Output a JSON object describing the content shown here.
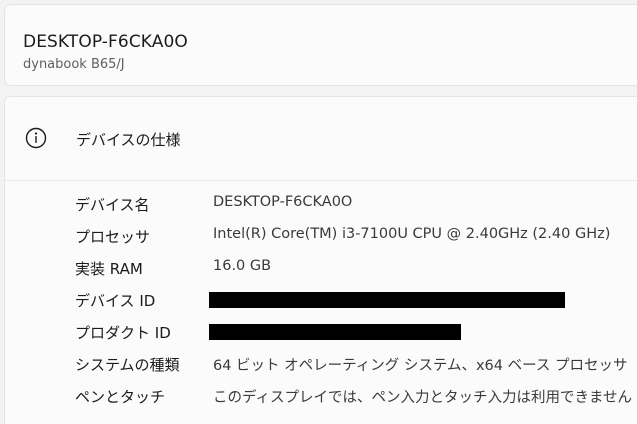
{
  "device": {
    "name": "DESKTOP-F6CKA0O",
    "model": "dynabook B65/J"
  },
  "specs": {
    "title": "デバイスの仕様",
    "icon": "info-icon",
    "rows": [
      {
        "label": "デバイス名",
        "value": "DESKTOP-F6CKA0O"
      },
      {
        "label": "プロセッサ",
        "value": "Intel(R) Core(TM) i3-7100U CPU @ 2.40GHz (2.40 GHz)"
      },
      {
        "label": "実装 RAM",
        "value": "16.0 GB"
      },
      {
        "label": "デバイス ID",
        "value": ""
      },
      {
        "label": "プロダクト ID",
        "value": ""
      },
      {
        "label": "システムの種類",
        "value": "64 ビット オペレーティング システム、x64 ベース プロセッサ"
      },
      {
        "label": "ペンとタッチ",
        "value": "このディスプレイでは、ペン入力とタッチ入力は利用できません"
      }
    ]
  },
  "colors": {
    "background": "#f3f3f3",
    "card": "#fbfbfb",
    "redaction": "#000000"
  }
}
